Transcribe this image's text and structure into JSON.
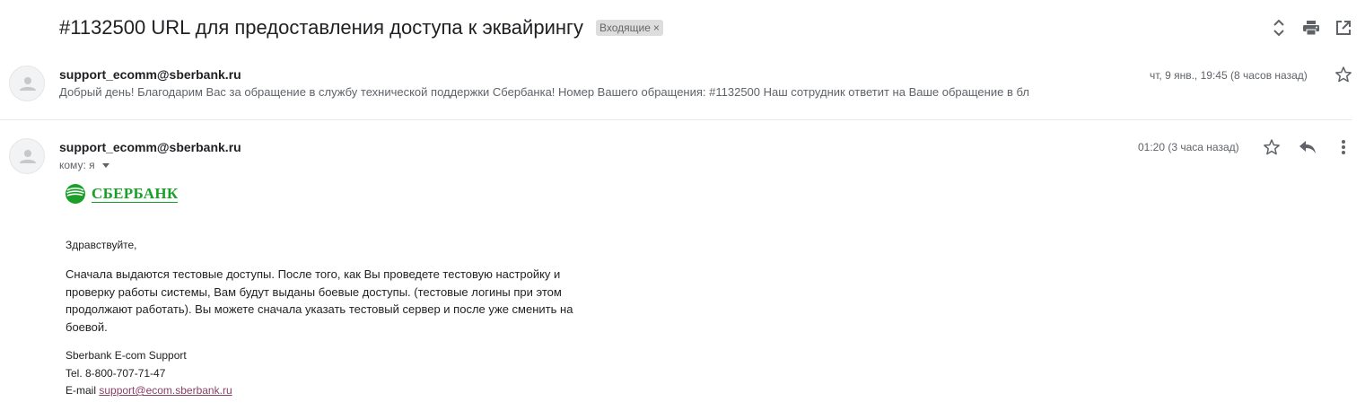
{
  "thread": {
    "subject": "#1132500 URL для предоставления доступа к эквайрингу",
    "label": "Входящие",
    "label_close": "×"
  },
  "toolbar": {
    "icons": [
      "expand-collapse-icon",
      "print-icon",
      "open-in-new-window-icon"
    ]
  },
  "messages": [
    {
      "sender": "support_ecomm@sberbank.ru",
      "snippet": "Добрый день! Благодарим Вас за обращение в службу технической поддержки Сбербанка! Номер Вашего обращения: #1132500 Наш сотрудник ответит на Ваше обращение в бл",
      "date": "чт, 9 янв., 19:45 (8 часов назад)"
    },
    {
      "sender": "support_ecomm@sberbank.ru",
      "to": "кому: я",
      "date": "01:20 (3 часа назад)",
      "logo_text": "СБЕРБАНК",
      "greeting": "Здравствуйте,",
      "paragraph": "Сначала выдаются тестовые доступы. После того, как Вы проведете тестовую настройку и проверку работы системы, Вам будут выданы боевые доступы. (тестовые логины при этом продолжают работать). Вы можете сначала указать тестовый сервер и после уже сменить на боевой.",
      "signature": {
        "name": "Sberbank E-com Support",
        "tel": "Tel. 8-800-707-71-47",
        "email_label": "E-mail",
        "email_link": "support@ecom.sberbank.ru"
      }
    }
  ],
  "colors": {
    "brand_green": "#1a9f29",
    "link": "#8a3f68",
    "muted": "#5f6368"
  }
}
